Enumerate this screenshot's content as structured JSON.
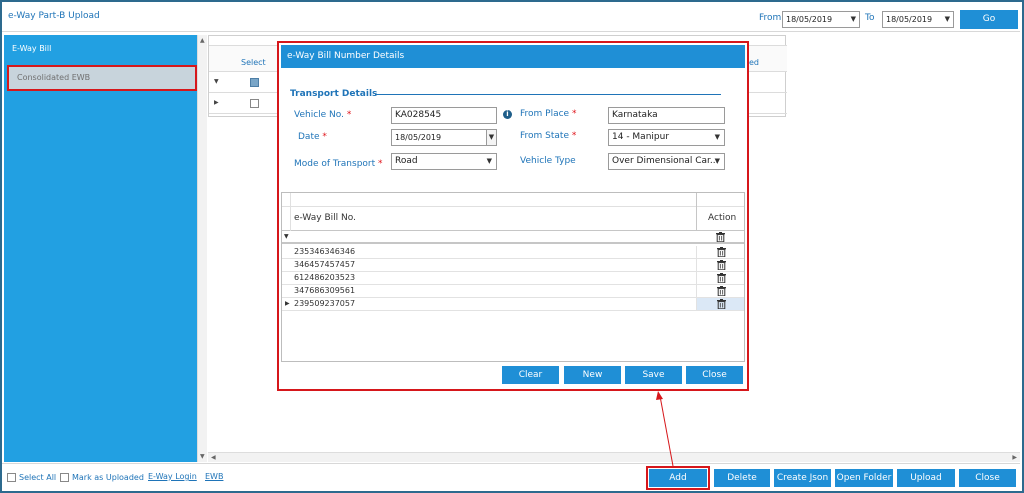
{
  "app": {
    "title": "e-Way Part-B Upload",
    "from_label": "From",
    "from_date": "18/05/2019",
    "to_label": "To",
    "to_date": "18/05/2019",
    "go_label": "Go"
  },
  "sidebar": {
    "items": [
      {
        "label": "E-Way Bill"
      },
      {
        "label": "Consolidated EWB"
      }
    ]
  },
  "grid": {
    "col_select": "Select",
    "col_partial": "ed"
  },
  "dialog": {
    "title": "e-Way Bill Number Details",
    "section_title": "Transport Details",
    "vehicle_no": {
      "label": "Vehicle No.",
      "value": "KA028545"
    },
    "date": {
      "label": "Date",
      "value": "18/05/2019"
    },
    "mode": {
      "label": "Mode of Transport",
      "value": "Road"
    },
    "from_place": {
      "label": "From Place",
      "value": "Karnataka"
    },
    "from_state": {
      "label": "From State",
      "value": "14 - Manipur"
    },
    "vehicle_type": {
      "label": "Vehicle Type",
      "value": "Over Dimensional Car..."
    },
    "table": {
      "col_bill": "e-Way Bill No.",
      "col_action": "Action",
      "rows": [
        "235346346346",
        "346457457457",
        "612486203523",
        "347686309561",
        "239509237057"
      ]
    },
    "buttons": {
      "clear": "Clear",
      "new": "New",
      "save": "Save",
      "close": "Close"
    }
  },
  "bottom": {
    "select_all": "Select All",
    "mark_uploaded": "Mark as Uploaded",
    "eway_login": "E-Way Login",
    "ewb": "EWB",
    "buttons": {
      "add": "Add",
      "delete": "Delete",
      "create_json": "Create Json",
      "open_folder": "Open Folder",
      "upload": "Upload",
      "close": "Close"
    }
  },
  "colors": {
    "accent": "#1f8fd6",
    "sidebar": "#22a0e2",
    "highlight": "#d6171b",
    "text_link": "#1f74b8"
  }
}
